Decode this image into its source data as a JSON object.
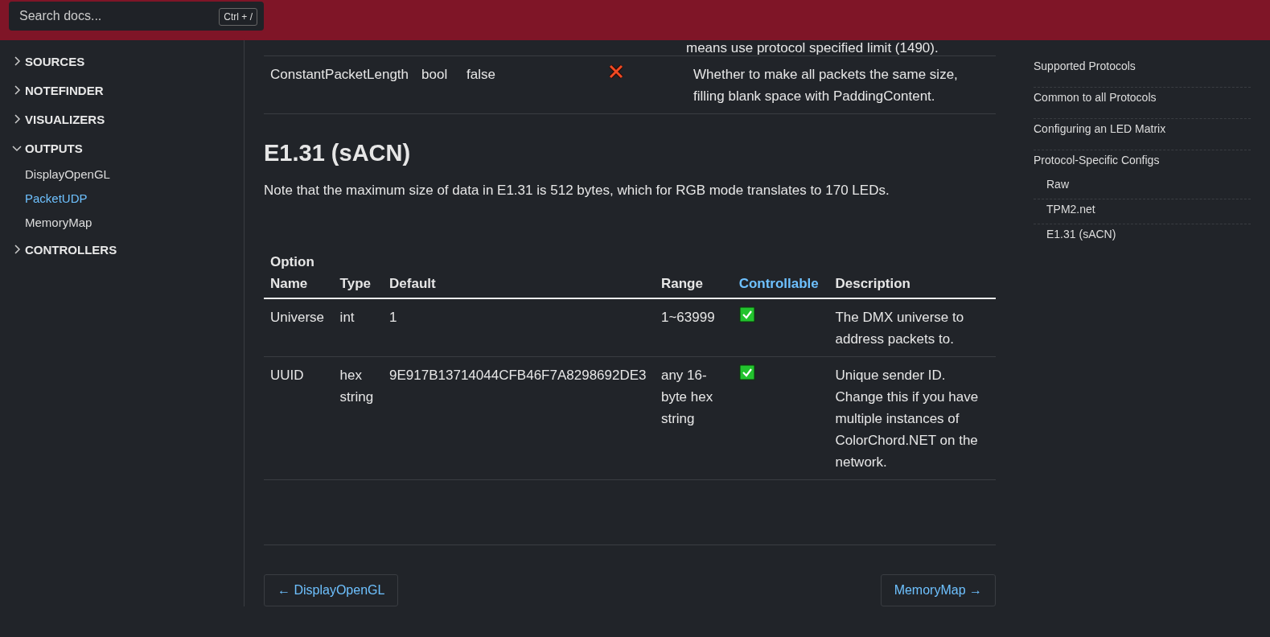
{
  "header": {
    "search": {
      "placeholder": "Search docs...",
      "shortcut": "Ctrl + /"
    }
  },
  "sidebar": {
    "items": [
      {
        "label": "SOURCES",
        "expanded": false
      },
      {
        "label": "NOTEFINDER",
        "expanded": false
      },
      {
        "label": "VISUALIZERS",
        "expanded": false
      },
      {
        "label": "OUTPUTS",
        "expanded": true,
        "children": [
          {
            "label": "DisplayOpenGL",
            "selected": false
          },
          {
            "label": "PacketUDP",
            "selected": true
          },
          {
            "label": "MemoryMap",
            "selected": false
          }
        ]
      },
      {
        "label": "CONTROLLERS",
        "expanded": false
      }
    ]
  },
  "content": {
    "previous_table": {
      "cut_text": "means use protocol specified limit (1490).",
      "rows": [
        {
          "cells": [
            "ConstantPacketLength",
            "bool",
            "false"
          ],
          "controllable": false,
          "description": "Whether to make all packets the same size, filling blank space with PaddingContent."
        }
      ]
    },
    "heading": "E1.31 (sACN)",
    "note": "Note that the maximum size of data in E1.31 is 512 bytes, which for RGB mode translates to 170 LEDs.",
    "table": {
      "columns": [
        {
          "label": "Option Name",
          "kind": "plain"
        },
        {
          "label": "Type",
          "kind": "plain"
        },
        {
          "label": "Default",
          "kind": "plain"
        },
        {
          "label": "Range",
          "kind": "plain"
        },
        {
          "label": "Controllable",
          "kind": "link"
        },
        {
          "label": "Description",
          "kind": "plain"
        }
      ],
      "rows": [
        {
          "cells": [
            "Universe",
            "int",
            "1",
            "1~63999"
          ],
          "controllable": true,
          "description": "The DMX universe to address packets to."
        },
        {
          "cells": [
            "UUID",
            "hex string",
            "9E917B13714044CFB46F7A8298692DE3",
            "any 16-byte hex string"
          ],
          "controllable": true,
          "description": "Unique sender ID. Change this if you have multiple instances of ColorChord.NET on the network."
        }
      ]
    },
    "pager": {
      "previous": "← DisplayOpenGL",
      "next": "MemoryMap →"
    }
  },
  "toc": {
    "items": [
      {
        "label": "Supported Protocols"
      },
      {
        "label": "Common to all Protocols"
      },
      {
        "label": "Configuring an LED Matrix"
      },
      {
        "label": "Protocol-Specific Configs",
        "children": [
          {
            "label": "Raw"
          },
          {
            "label": "TPM2.net"
          },
          {
            "label": "E1.31 (sACN)"
          }
        ]
      }
    ]
  }
}
